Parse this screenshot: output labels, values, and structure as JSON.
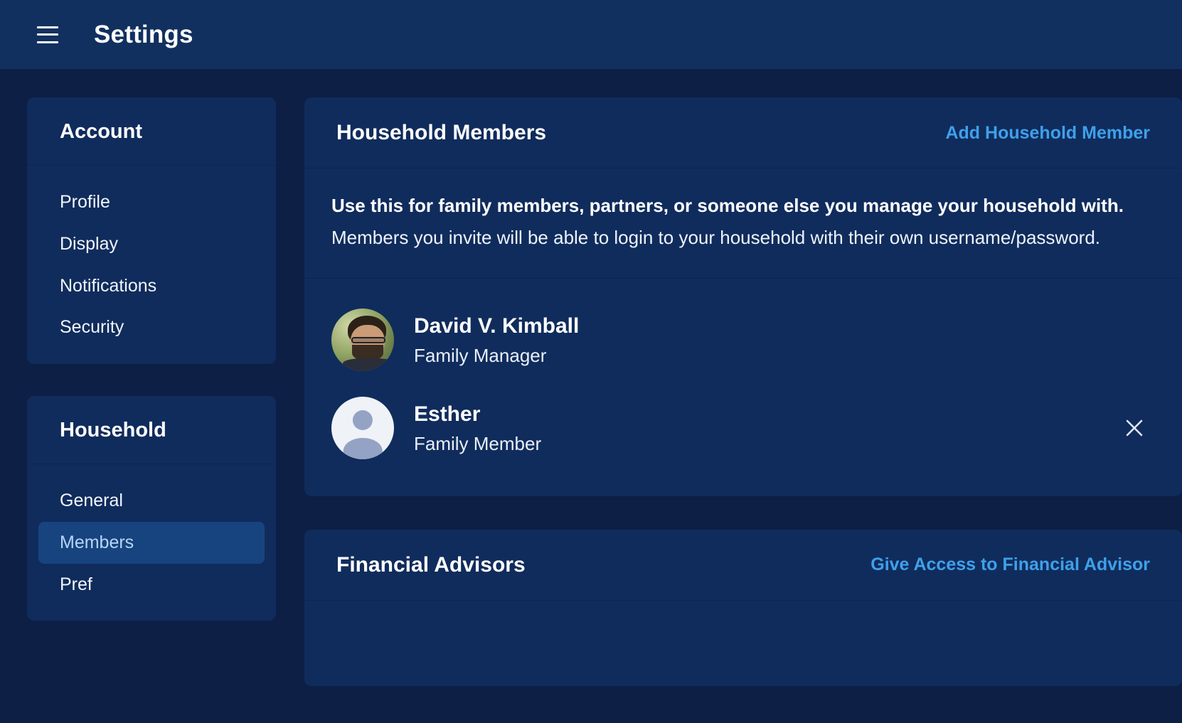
{
  "appbar": {
    "menu_icon": "hamburger-menu-icon",
    "title": "Settings"
  },
  "colors": {
    "page_background": "#0d1f44",
    "appbar_background": "#12305f",
    "card_background": "#102c5c",
    "accent_link": "#3fa0ea",
    "active_item_background": "#17447e",
    "active_item_text": "#b7d6f7",
    "divider": "#0b2650"
  },
  "sidebar": {
    "groups": [
      {
        "title": "Account",
        "items": [
          {
            "label": "Profile",
            "active": false
          },
          {
            "label": "Display",
            "active": false
          },
          {
            "label": "Notifications",
            "active": false
          },
          {
            "label": "Security",
            "active": false
          }
        ]
      },
      {
        "title": "Household",
        "items": [
          {
            "label": "General",
            "active": false
          },
          {
            "label": "Members",
            "active": true
          },
          {
            "label": "Pref",
            "active": false
          }
        ]
      }
    ]
  },
  "main": {
    "household_members": {
      "title": "Household Members",
      "action_label": "Add Household Member",
      "description_bold": "Use this for family members, partners, or someone else you manage your household with.",
      "description_rest": " Members you invite will be able to login to your household with their own username/password.",
      "members": [
        {
          "name": "David V. Kimball",
          "role": "Family Manager",
          "avatar_type": "photo",
          "removable": false
        },
        {
          "name": "Esther",
          "role": "Family Member",
          "avatar_type": "placeholder",
          "removable": true,
          "remove_icon": "close-icon"
        }
      ]
    },
    "financial_advisors": {
      "title": "Financial Advisors",
      "action_label": "Give Access to Financial Advisor"
    }
  }
}
